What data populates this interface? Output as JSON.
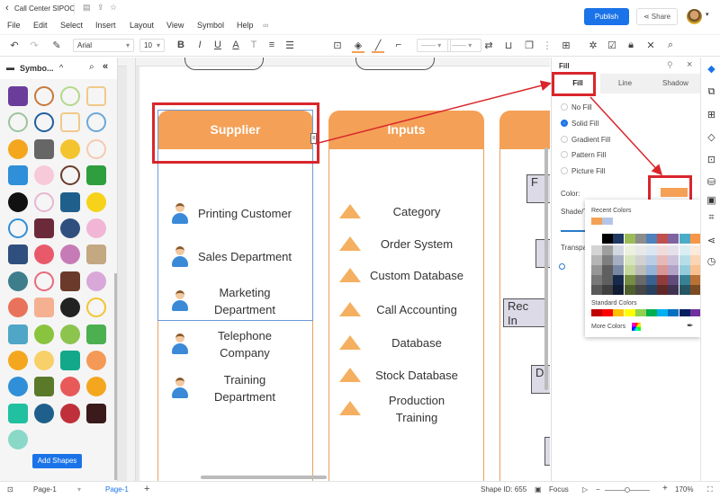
{
  "app": {
    "doc_title": "Call Center SIPOC",
    "publish": "Publish",
    "share": "Share"
  },
  "menu": [
    "File",
    "Edit",
    "Select",
    "Insert",
    "Layout",
    "View",
    "Symbol",
    "Help"
  ],
  "toolbar": {
    "font": "Arial",
    "size": "10"
  },
  "library": {
    "title": "Symbo...",
    "add_shapes": "Add Shapes",
    "symbols": [
      [
        "chevrons",
        "#6a3d9a"
      ],
      [
        "star-outline",
        "#c8793c"
      ],
      [
        "cloud-outline",
        "#b5d88b"
      ],
      [
        "trefoil-outline",
        "#f1c98a"
      ],
      [
        "pentagon-outline",
        "#9cc49c"
      ],
      [
        "gear-ring",
        "#1f5f9e"
      ],
      [
        "sun-ring",
        "#f1c98a"
      ],
      [
        "frame-outline",
        "#6ba7d8"
      ],
      [
        "gear-sun",
        "#f4a71e"
      ],
      [
        "rain-cloud",
        "#666666"
      ],
      [
        "yellow-rain-cloud",
        "#f4c430"
      ],
      [
        "pink-frame",
        "#f7c9b0"
      ],
      [
        "blue-starburst",
        "#2f8fd8"
      ],
      [
        "pink-circle",
        "#f8c9d8"
      ],
      [
        "brown-ring",
        "#6b3a2a"
      ],
      [
        "green-ornament",
        "#2e9e3e"
      ],
      [
        "black-badge",
        "#111111"
      ],
      [
        "pink-corner",
        "#e8b6d0"
      ],
      [
        "navy-star",
        "#1f5f8b"
      ],
      [
        "yellow-star",
        "#f7d21a"
      ],
      [
        "blue-star-outline",
        "#2f8fd8"
      ],
      [
        "maroon-diamond",
        "#6b2a3a"
      ],
      [
        "navy-4star",
        "#2f4f7f"
      ],
      [
        "pink-hexagon",
        "#f1b6d6"
      ],
      [
        "navy-bowl",
        "#2f4f7f"
      ],
      [
        "heart-knot",
        "#e85a6a"
      ],
      [
        "purple-drop",
        "#c77bb6"
      ],
      [
        "tan-triangle",
        "#c4a882"
      ],
      [
        "teal-banner",
        "#3e7d8c"
      ],
      [
        "pink-hex-ring",
        "#e86a7a"
      ],
      [
        "brown-sun",
        "#6b3a2a"
      ],
      [
        "lilac-flower",
        "#d8a8d8"
      ],
      [
        "hexagram",
        "#e8735a"
      ],
      [
        "peach-flower",
        "#f4b090"
      ],
      [
        "pinwheel",
        "#222222"
      ],
      [
        "rings",
        "#f4c430"
      ],
      [
        "swirl-flower",
        "#4fa6c6"
      ],
      [
        "color-orb",
        "#8ac43e"
      ],
      [
        "green-x",
        "#8cc44e"
      ],
      [
        "green-tree",
        "#4caf50"
      ],
      [
        "maple-leaf",
        "#f4a71e"
      ],
      [
        "yellow-cloud",
        "#f7d06a"
      ],
      [
        "teal-leaf",
        "#14a88a"
      ],
      [
        "orange-drop",
        "#f49a56"
      ],
      [
        "chess-piece",
        "#2f8fd8"
      ],
      [
        "olive-blob",
        "#5a7a2a"
      ],
      [
        "red-blob",
        "#e85a5a"
      ],
      [
        "puzzle",
        "#f4a71e"
      ],
      [
        "teal-tree",
        "#20c0a0"
      ],
      [
        "balloon-navy",
        "#1f5f8b"
      ],
      [
        "balloon-red",
        "#c0303a"
      ],
      [
        "chain",
        "#3a1a1a"
      ],
      [
        "globe",
        "#8ad8c8"
      ]
    ]
  },
  "diagram": {
    "supplier": {
      "title": "Supplier",
      "items": [
        "Printing Customer",
        "Sales Department",
        "Marketing\nDepartment",
        "Telephone\nCompany",
        "Training\nDepartment"
      ]
    },
    "inputs": {
      "title": "Inputs",
      "items": [
        "Category",
        "Order System",
        "Custom Database",
        "Call Accounting",
        "Database",
        "Stock Database",
        "Production\nTraining"
      ]
    },
    "process_fragments": [
      "F",
      "",
      "Rec\nIn",
      "D",
      ""
    ]
  },
  "fill_panel": {
    "title": "Fill",
    "tabs": [
      "Fill",
      "Line",
      "Shadow"
    ],
    "active_tab": "Fill",
    "options": [
      "No Fill",
      "Solid Fill",
      "Gradient Fill",
      "Pattern Fill",
      "Picture Fill"
    ],
    "selected": "Solid Fill",
    "color_label": "Color:",
    "color_value": "#f4a056",
    "shade_label": "Shade/T",
    "transparency_label": "Transpa"
  },
  "color_popup": {
    "recent_label": "Recent Colors",
    "recent": [
      "#f4a056",
      "#b4c6e7"
    ],
    "theme": [
      "#ffffff",
      "#000000",
      "#1f3864",
      "#9bbb59",
      "#8c8c8c",
      "#4f81bd",
      "#c0504d",
      "#8064a2",
      "#4bacc6",
      "#f79646"
    ],
    "standard_label": "Standard Colors",
    "standard": [
      "#c00000",
      "#ff0000",
      "#ffc000",
      "#ffff00",
      "#92d050",
      "#00b050",
      "#00b0f0",
      "#0070c0",
      "#002060",
      "#7030a0"
    ],
    "more_colors": "More Colors"
  },
  "status": {
    "page_select": "Page-1",
    "page_tab": "Page-1",
    "shape_id": "Shape ID: 655",
    "focus": "Focus",
    "zoom": "170%"
  },
  "colors": {
    "accent": "#1a73e8",
    "annotation": "#d9262c",
    "header_orange": "#f4a056"
  }
}
